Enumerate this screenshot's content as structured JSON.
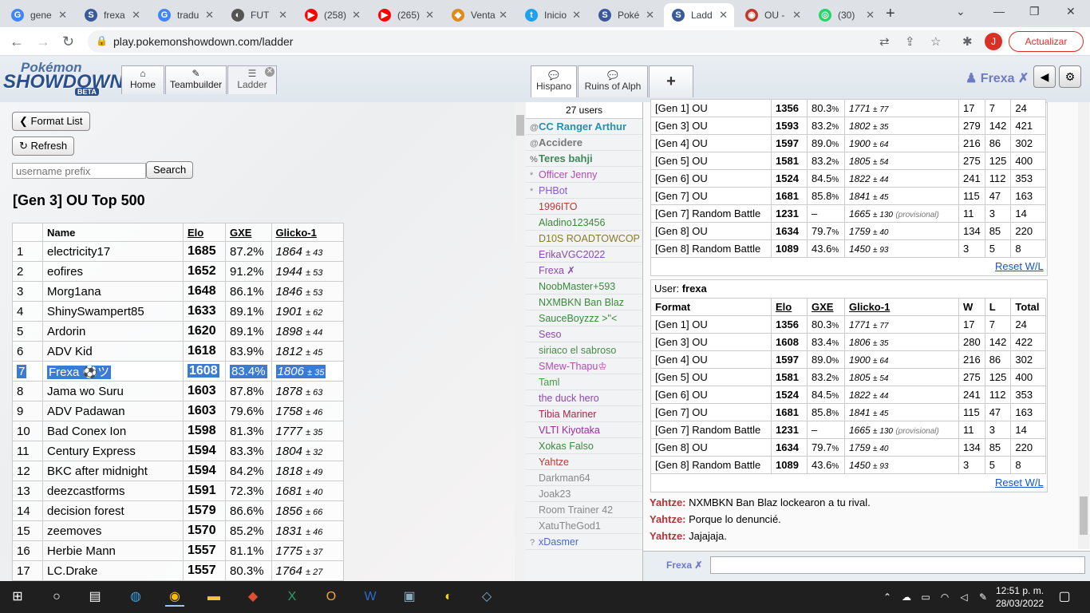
{
  "browser_tabs": [
    {
      "label": "gene",
      "fav": "G",
      "color": "#4285f4"
    },
    {
      "label": "frexa",
      "fav": "S",
      "color": "#3a5a9a"
    },
    {
      "label": "tradu",
      "fav": "G",
      "color": "#4285f4"
    },
    {
      "label": "FUT",
      "fav": "◐",
      "color": "#555"
    },
    {
      "label": "(258)",
      "fav": "▶",
      "color": "#ff0000"
    },
    {
      "label": "(265)",
      "fav": "▶",
      "color": "#ff0000"
    },
    {
      "label": "Venta",
      "fav": "◆",
      "color": "#e08a1e"
    },
    {
      "label": "Inicio",
      "fav": "t",
      "color": "#1da1f2"
    },
    {
      "label": "Poké",
      "fav": "S",
      "color": "#3a5a9a"
    },
    {
      "label": "Ladd",
      "fav": "S",
      "color": "#3a5a9a"
    },
    {
      "label": "OU -",
      "fav": "◉",
      "color": "#c0392b"
    },
    {
      "label": "(30)",
      "fav": "◎",
      "color": "#25d366"
    }
  ],
  "address_bar": {
    "url": "play.pokemonshowdown.com/ladder"
  },
  "update_button": "Actualizar",
  "profile_initial": "J",
  "ps": {
    "logo_top": "Pokémon",
    "logo_main": "SHOWDOWN",
    "logo_badge": "BETA",
    "tabs": {
      "home": "Home",
      "teambuilder": "Teambuilder",
      "ladder": "Ladder"
    },
    "chat_tabs": {
      "hispano": "Hispano",
      "ruins": "Ruins of Alph",
      "add": "+"
    },
    "username": "Frexa ✗"
  },
  "ladder": {
    "format_list_button": "Format List",
    "refresh_button": "Refresh",
    "search_placeholder": "username prefix",
    "search_button": "Search",
    "title": "[Gen 3] OU Top 500",
    "headers": {
      "rank": "",
      "name": "Name",
      "elo": "Elo",
      "gxe": "GXE",
      "glicko": "Glicko-1"
    },
    "rows": [
      {
        "rank": "1",
        "name": "electricity17",
        "elo": "1685",
        "gxe": "87.2%",
        "glicko": "1864",
        "dev": "± 43"
      },
      {
        "rank": "2",
        "name": "eofires",
        "elo": "1652",
        "gxe": "91.2%",
        "glicko": "1944",
        "dev": "± 53"
      },
      {
        "rank": "3",
        "name": "Morg1ana",
        "elo": "1648",
        "gxe": "86.1%",
        "glicko": "1846",
        "dev": "± 53"
      },
      {
        "rank": "4",
        "name": "ShinySwampert85",
        "elo": "1633",
        "gxe": "89.1%",
        "glicko": "1901",
        "dev": "± 62"
      },
      {
        "rank": "5",
        "name": "Ardorin",
        "elo": "1620",
        "gxe": "89.1%",
        "glicko": "1898",
        "dev": "± 44"
      },
      {
        "rank": "6",
        "name": "ADV Kid",
        "elo": "1618",
        "gxe": "83.9%",
        "glicko": "1812",
        "dev": "± 45"
      },
      {
        "rank": "7",
        "name": "Frexa ⚽ツ",
        "elo": "1608",
        "gxe": "83.4%",
        "glicko": "1806",
        "dev": "± 35",
        "highlight": true
      },
      {
        "rank": "8",
        "name": "Jama wo Suru",
        "elo": "1603",
        "gxe": "87.8%",
        "glicko": "1878",
        "dev": "± 63"
      },
      {
        "rank": "9",
        "name": "ADV Padawan",
        "elo": "1603",
        "gxe": "79.6%",
        "glicko": "1758",
        "dev": "± 46"
      },
      {
        "rank": "10",
        "name": "Bad Conex Ion",
        "elo": "1598",
        "gxe": "81.3%",
        "glicko": "1777",
        "dev": "± 35"
      },
      {
        "rank": "11",
        "name": "Century Express",
        "elo": "1594",
        "gxe": "83.3%",
        "glicko": "1804",
        "dev": "± 32"
      },
      {
        "rank": "12",
        "name": "BKC after midnight",
        "elo": "1594",
        "gxe": "84.2%",
        "glicko": "1818",
        "dev": "± 49"
      },
      {
        "rank": "13",
        "name": "deezcastforms",
        "elo": "1591",
        "gxe": "72.3%",
        "glicko": "1681",
        "dev": "± 40"
      },
      {
        "rank": "14",
        "name": "decision forest",
        "elo": "1579",
        "gxe": "86.6%",
        "glicko": "1856",
        "dev": "± 66"
      },
      {
        "rank": "15",
        "name": "zeemoves",
        "elo": "1570",
        "gxe": "85.2%",
        "glicko": "1831",
        "dev": "± 46"
      },
      {
        "rank": "16",
        "name": "Herbie Mann",
        "elo": "1557",
        "gxe": "81.1%",
        "glicko": "1775",
        "dev": "± 37"
      },
      {
        "rank": "17",
        "name": "LC.Drake",
        "elo": "1557",
        "gxe": "80.3%",
        "glicko": "1764",
        "dev": "± 27"
      }
    ]
  },
  "userlist": {
    "count": "27 users",
    "users": [
      {
        "rank": "@",
        "name": "CC Ranger Arthur",
        "color": "#2a8fb3",
        "big": true
      },
      {
        "rank": "@",
        "name": "Accidere",
        "color": "#777",
        "big": true
      },
      {
        "rank": "%",
        "name": "Teres bahji",
        "color": "#3c8a5a",
        "big": true
      },
      {
        "rank": "*",
        "name": "Officer Jenny",
        "color": "#b04fb0"
      },
      {
        "rank": "*",
        "name": "PHBot",
        "color": "#8a5cc2"
      },
      {
        "rank": "",
        "name": "1996ITO",
        "color": "#b33a3a"
      },
      {
        "rank": "",
        "name": "Aladino123456",
        "color": "#3a8a3a"
      },
      {
        "rank": "",
        "name": "D10S ROADTOWCOP",
        "color": "#8a7a2a"
      },
      {
        "rank": "",
        "name": "ErikaVGC2022",
        "color": "#8a4ab0"
      },
      {
        "rank": "",
        "name": "Frexa ✗",
        "color": "#8a4ab0"
      },
      {
        "rank": "",
        "name": "NoobMaster+593",
        "color": "#3a8a3a"
      },
      {
        "rank": "",
        "name": "NXMBKN Ban Blaz",
        "color": "#3a8a3a"
      },
      {
        "rank": "",
        "name": "SauceBoyzzz >\"<",
        "color": "#3a8a3a"
      },
      {
        "rank": "",
        "name": "Seso",
        "color": "#8a4ab0"
      },
      {
        "rank": "",
        "name": "siriaco el sabroso",
        "color": "#4a8a4a"
      },
      {
        "rank": "",
        "name": "SMew-Thapu♔",
        "color": "#b04fb0"
      },
      {
        "rank": "",
        "name": "Taml",
        "color": "#4a9a4a"
      },
      {
        "rank": "",
        "name": "the duck hero",
        "color": "#8a4ab0"
      },
      {
        "rank": "",
        "name": "Tibia Mariner",
        "color": "#a02a4a"
      },
      {
        "rank": "",
        "name": "VLTI Kiyotaka",
        "color": "#a02aa0"
      },
      {
        "rank": "",
        "name": "Xokas Falso",
        "color": "#3a8a3a"
      },
      {
        "rank": "",
        "name": "Yahtze",
        "color": "#b33a3a"
      },
      {
        "rank": "",
        "name": "Darkman64",
        "color": "#888"
      },
      {
        "rank": "",
        "name": "Joak23",
        "color": "#888"
      },
      {
        "rank": "",
        "name": "Room Trainer 42",
        "color": "#888"
      },
      {
        "rank": "",
        "name": "XatuTheGod1",
        "color": "#888"
      },
      {
        "rank": "?",
        "name": "xDasmer",
        "color": "#4a6ac2"
      }
    ]
  },
  "stats_top": {
    "rows": [
      {
        "format": "[Gen 1] OU",
        "elo": "1356",
        "gxe": "80.3",
        "glicko": "1771",
        "dev": "± 77",
        "w": "17",
        "l": "7",
        "t": "24"
      },
      {
        "format": "[Gen 3] OU",
        "elo": "1593",
        "gxe": "83.2",
        "glicko": "1802",
        "dev": "± 35",
        "w": "279",
        "l": "142",
        "t": "421"
      },
      {
        "format": "[Gen 4] OU",
        "elo": "1597",
        "gxe": "89.0",
        "glicko": "1900",
        "dev": "± 64",
        "w": "216",
        "l": "86",
        "t": "302"
      },
      {
        "format": "[Gen 5] OU",
        "elo": "1581",
        "gxe": "83.2",
        "glicko": "1805",
        "dev": "± 54",
        "w": "275",
        "l": "125",
        "t": "400"
      },
      {
        "format": "[Gen 6] OU",
        "elo": "1524",
        "gxe": "84.5",
        "glicko": "1822",
        "dev": "± 44",
        "w": "241",
        "l": "112",
        "t": "353"
      },
      {
        "format": "[Gen 7] OU",
        "elo": "1681",
        "gxe": "85.8",
        "glicko": "1841",
        "dev": "± 45",
        "w": "115",
        "l": "47",
        "t": "163"
      },
      {
        "format": "[Gen 7] Random Battle",
        "elo": "1231",
        "gxe": "–",
        "glicko": "1665",
        "dev": "± 130",
        "prov": "(provisional)",
        "w": "11",
        "l": "3",
        "t": "14"
      },
      {
        "format": "[Gen 8] OU",
        "elo": "1634",
        "gxe": "79.7",
        "glicko": "1759",
        "dev": "± 40",
        "w": "134",
        "l": "85",
        "t": "220"
      },
      {
        "format": "[Gen 8] Random Battle",
        "elo": "1089",
        "gxe": "43.6",
        "glicko": "1450",
        "dev": "± 93",
        "w": "3",
        "l": "5",
        "t": "8"
      }
    ],
    "reset": "Reset W/L"
  },
  "stats_user": {
    "user_label": "User:",
    "user_name": "frexa",
    "headers": {
      "format": "Format",
      "elo": "Elo",
      "gxe": "GXE",
      "glicko": "Glicko-1",
      "w": "W",
      "l": "L",
      "t": "Total"
    },
    "rows": [
      {
        "format": "[Gen 1] OU",
        "elo": "1356",
        "gxe": "80.3",
        "glicko": "1771",
        "dev": "± 77",
        "w": "17",
        "l": "7",
        "t": "24"
      },
      {
        "format": "[Gen 3] OU",
        "elo": "1608",
        "gxe": "83.4",
        "glicko": "1806",
        "dev": "± 35",
        "w": "280",
        "l": "142",
        "t": "422"
      },
      {
        "format": "[Gen 4] OU",
        "elo": "1597",
        "gxe": "89.0",
        "glicko": "1900",
        "dev": "± 64",
        "w": "216",
        "l": "86",
        "t": "302"
      },
      {
        "format": "[Gen 5] OU",
        "elo": "1581",
        "gxe": "83.2",
        "glicko": "1805",
        "dev": "± 54",
        "w": "275",
        "l": "125",
        "t": "400"
      },
      {
        "format": "[Gen 6] OU",
        "elo": "1524",
        "gxe": "84.5",
        "glicko": "1822",
        "dev": "± 44",
        "w": "241",
        "l": "112",
        "t": "353"
      },
      {
        "format": "[Gen 7] OU",
        "elo": "1681",
        "gxe": "85.8",
        "glicko": "1841",
        "dev": "± 45",
        "w": "115",
        "l": "47",
        "t": "163"
      },
      {
        "format": "[Gen 7] Random Battle",
        "elo": "1231",
        "gxe": "–",
        "glicko": "1665",
        "dev": "± 130",
        "prov": "(provisional)",
        "w": "11",
        "l": "3",
        "t": "14"
      },
      {
        "format": "[Gen 8] OU",
        "elo": "1634",
        "gxe": "79.7",
        "glicko": "1759",
        "dev": "± 40",
        "w": "134",
        "l": "85",
        "t": "220"
      },
      {
        "format": "[Gen 8] Random Battle",
        "elo": "1089",
        "gxe": "43.6",
        "glicko": "1450",
        "dev": "± 93",
        "w": "3",
        "l": "5",
        "t": "8"
      }
    ],
    "reset": "Reset W/L"
  },
  "chat": {
    "messages": [
      {
        "user": "Yahtze:",
        "text": "NXMBKN Ban Blaz lockearon a tu rival."
      },
      {
        "user": "Yahtze:",
        "text": "Porque lo denuncié."
      },
      {
        "user": "Yahtze:",
        "text": "Jajajaja."
      }
    ],
    "input_name": "Frexa ✗"
  },
  "taskbar": {
    "time": "12:51 p. m.",
    "date": "28/03/2022"
  }
}
